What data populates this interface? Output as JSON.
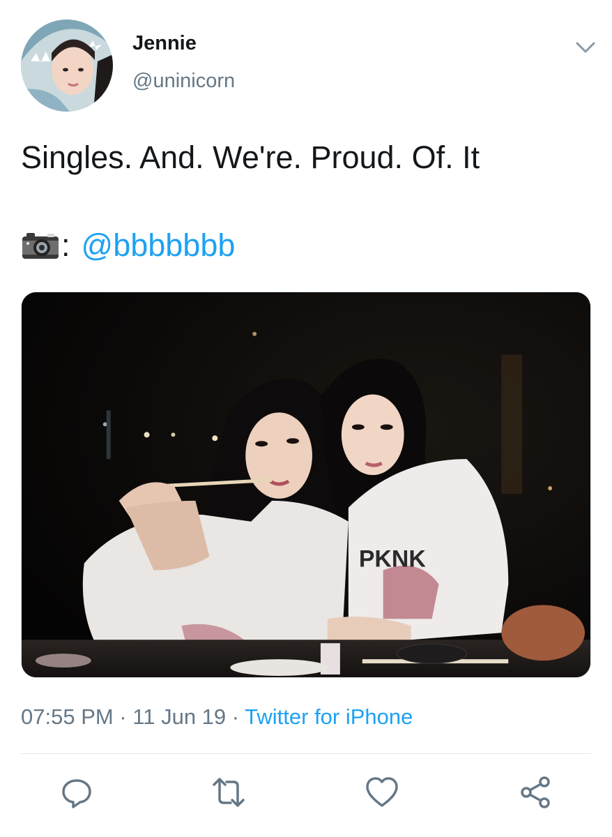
{
  "author": {
    "display_name": "Jennie",
    "handle": "@uninicorn"
  },
  "tweet": {
    "text": "Singles. And. We're. Proud. Of. It",
    "credit_separator": ":",
    "mention": "@bbbbbbb"
  },
  "meta": {
    "time": "07:55 PM",
    "date": "11 Jun 19",
    "source": "Twitter for iPhone",
    "separator": "·"
  },
  "icons": {
    "caret": "chevron-down-icon",
    "camera": "camera-icon",
    "reply": "reply-icon",
    "retweet": "retweet-icon",
    "like": "heart-icon",
    "share": "share-icon"
  },
  "colors": {
    "link": "#1da1f2",
    "secondary_text": "#657786",
    "primary_text": "#14171a",
    "divider": "#e1e8ed"
  }
}
